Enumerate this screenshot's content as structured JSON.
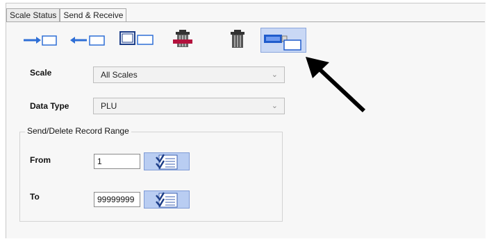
{
  "tabs": [
    {
      "label": "Scale Status",
      "active": false
    },
    {
      "label": "Send & Receive",
      "active": true
    }
  ],
  "toolbar": {
    "buttons": [
      {
        "icon": "send-arrow-icon",
        "selected": false
      },
      {
        "icon": "receive-arrow-icon",
        "selected": false
      },
      {
        "icon": "monitor-display-icon",
        "selected": false
      },
      {
        "icon": "delete-bin-red-icon",
        "selected": false
      },
      {
        "icon": "delete-bin-icon",
        "selected": false
      },
      {
        "icon": "usb-drive-icon",
        "selected": true
      }
    ]
  },
  "form": {
    "scale": {
      "label": "Scale",
      "value": "All Scales"
    },
    "data_type": {
      "label": "Data Type",
      "value": "PLU"
    },
    "range": {
      "title": "Send/Delete Record Range",
      "from": {
        "label": "From",
        "value": "1"
      },
      "to": {
        "label": "To",
        "value": "99999999"
      }
    }
  },
  "colors": {
    "selected_button": "#c9d8f5",
    "list_button": "#b9cdf2",
    "accent_blue": "#2f6fd6",
    "red": "#b3123d"
  }
}
